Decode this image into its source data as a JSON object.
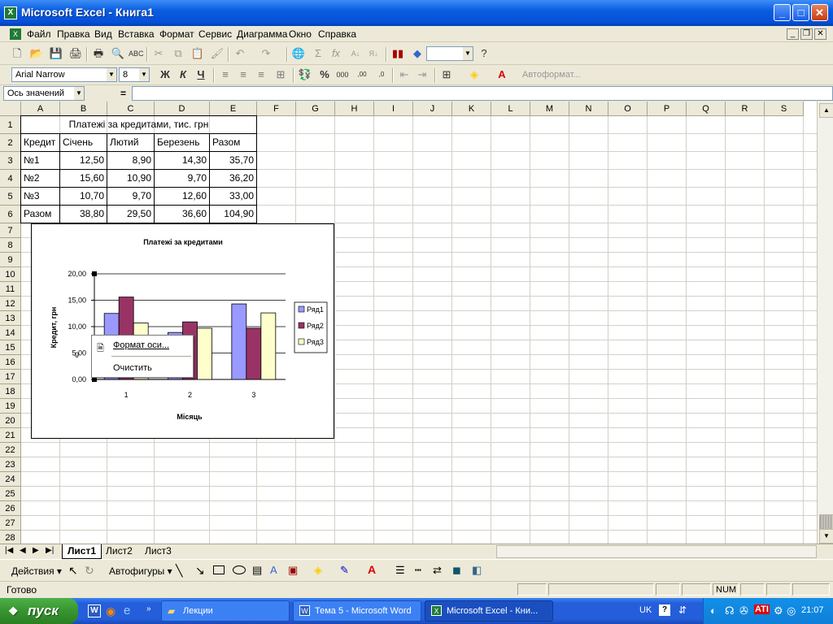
{
  "window": {
    "title": "Microsoft Excel - Книга1"
  },
  "menu": [
    "Файл",
    "Правка",
    "Вид",
    "Вставка",
    "Формат",
    "Сервис",
    "Диаграмма",
    "Окно",
    "Справка"
  ],
  "format_toolbar": {
    "font": "Arial Narrow",
    "size": "8",
    "autoformat": "Автоформат..."
  },
  "formula_bar": {
    "name_box": "Ось значений",
    "equals": "="
  },
  "columns": [
    "A",
    "B",
    "C",
    "D",
    "E",
    "F",
    "G",
    "H",
    "I",
    "J",
    "K",
    "L",
    "M",
    "N",
    "O",
    "P",
    "Q",
    "R",
    "S"
  ],
  "rows": [
    "1",
    "2",
    "3",
    "4",
    "5",
    "6",
    "7",
    "8",
    "9",
    "10",
    "11",
    "12",
    "13",
    "14",
    "15",
    "16",
    "17",
    "18",
    "19",
    "20",
    "21",
    "22",
    "23",
    "24",
    "25",
    "26",
    "27",
    "28"
  ],
  "table": {
    "title": "Платежі за кредитами, тис. грн",
    "header": [
      "Кредит",
      "Січень",
      "Лютий",
      "Березень",
      "Разом"
    ],
    "rows": [
      [
        "№1",
        "12,50",
        "8,90",
        "14,30",
        "35,70"
      ],
      [
        "№2",
        "15,60",
        "10,90",
        "9,70",
        "36,20"
      ],
      [
        "№3",
        "10,70",
        "9,70",
        "12,60",
        "33,00"
      ],
      [
        "Разом",
        "38,80",
        "29,50",
        "36,60",
        "104,90"
      ]
    ]
  },
  "chart_data": {
    "type": "bar",
    "title": "Платежі за кредитами",
    "xlabel": "Місяць",
    "ylabel": "Кредит, грн",
    "categories": [
      "1",
      "2",
      "3"
    ],
    "series": [
      {
        "name": "Ряд1",
        "values": [
          12.5,
          8.9,
          14.3
        ],
        "color": "#9999ff"
      },
      {
        "name": "Ряд2",
        "values": [
          15.6,
          10.9,
          9.7
        ],
        "color": "#993366"
      },
      {
        "name": "Ряд3",
        "values": [
          10.7,
          9.7,
          12.6
        ],
        "color": "#ffffcc"
      }
    ],
    "ylim": [
      0,
      20
    ],
    "yticks": [
      "0,00",
      "5,00",
      "10,00",
      "15,00",
      "20,00"
    ],
    "legend": "right",
    "grid": true
  },
  "context_menu": {
    "items": [
      "Формат оси...",
      "Очистить"
    ],
    "partial_label": "0"
  },
  "sheet_tabs": [
    "Лист1",
    "Лист2",
    "Лист3"
  ],
  "draw_toolbar": {
    "actions": "Действия",
    "autoshapes": "Автофигуры"
  },
  "status": {
    "ready": "Готово",
    "num": "NUM"
  },
  "taskbar": {
    "start": "пуск",
    "tasks": [
      "Лекции",
      "Тема 5 - Microsoft Word",
      "Microsoft Excel - Кни..."
    ],
    "lang": "UK",
    "clock": "21:07"
  }
}
